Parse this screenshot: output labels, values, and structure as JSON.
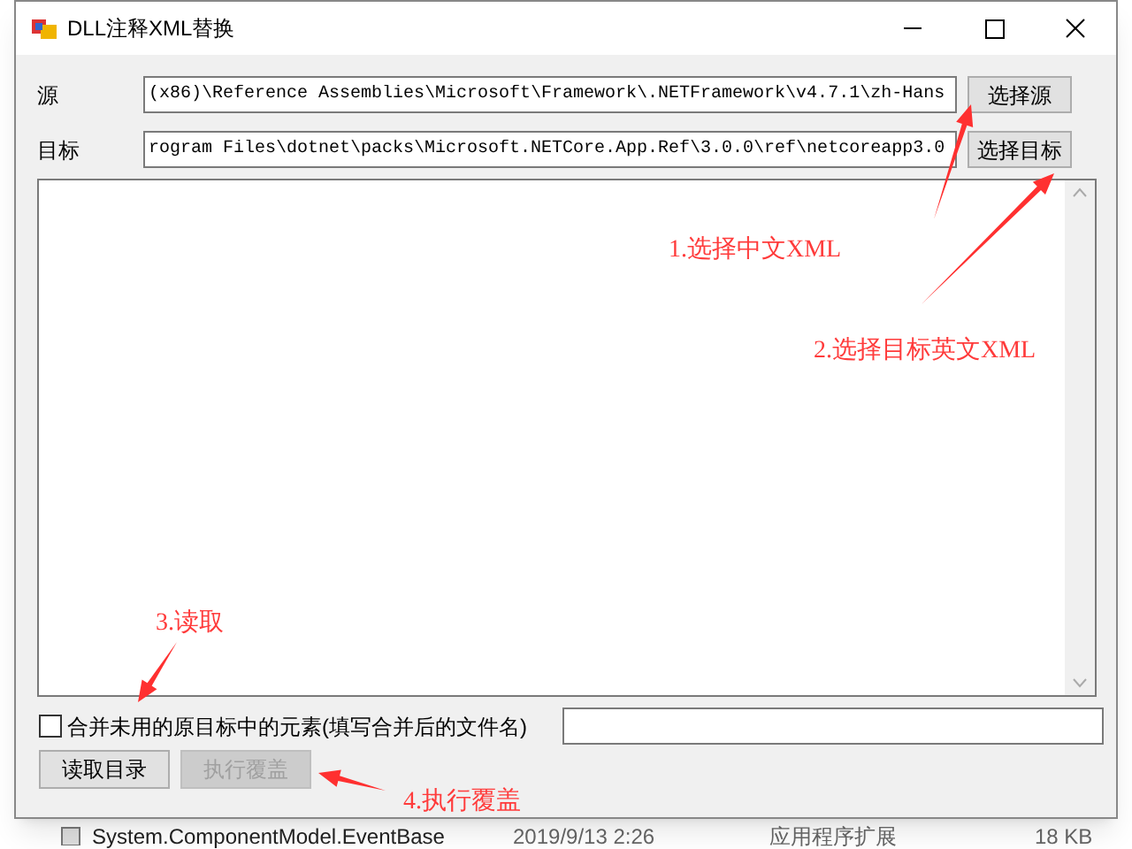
{
  "window": {
    "title": "DLL注释XML替换"
  },
  "fields": [
    {
      "label": "源",
      "value": "(x86)\\Reference Assemblies\\Microsoft\\Framework\\.NETFramework\\v4.7.1\\zh-Hans",
      "button": "选择源"
    },
    {
      "label": "目标",
      "value": "rogram Files\\dotnet\\packs\\Microsoft.NETCore.App.Ref\\3.0.0\\ref\\netcoreapp3.0",
      "button": "选择目标"
    }
  ],
  "merge": {
    "label": "合并未用的原目标中的元素(填写合并后的文件名)",
    "checked": false
  },
  "buttons": [
    {
      "label": "读取目录",
      "disabled": false
    },
    {
      "label": "执行覆盖",
      "disabled": true
    }
  ],
  "annotations": [
    "1.选择中文XML",
    "2.选择目标英文XML",
    "3.读取",
    "4.执行覆盖"
  ],
  "background_row": [
    "System.ComponentModel.EventBase",
    "2019/9/13 2:26",
    "应用程序扩展",
    "18 KB"
  ]
}
